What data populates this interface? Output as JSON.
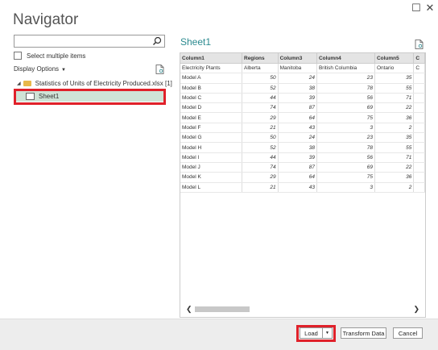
{
  "window": {
    "maximize_glyph": "☐",
    "close_glyph": "✕"
  },
  "title": "Navigator",
  "search": {
    "value": "",
    "placeholder": ""
  },
  "select_multiple_label": "Select multiple items",
  "display_options_label": "Display Options",
  "tree": {
    "file_label": "Statistics of Units of Electricity Produced.xlsx [1]",
    "sheet_label": "Sheet1"
  },
  "preview": {
    "title": "Sheet1",
    "headers": [
      "Column1",
      "Regions",
      "Column3",
      "Column4",
      "Column5",
      "C"
    ],
    "subheader": [
      "Electricity Plants",
      "Alberta",
      "Manitoba",
      "British Columbia",
      "Ontario",
      "C"
    ],
    "rows": [
      [
        "Model A",
        "50",
        "24",
        "23",
        "35"
      ],
      [
        "Model B",
        "52",
        "38",
        "78",
        "55"
      ],
      [
        "Model C",
        "44",
        "39",
        "56",
        "71"
      ],
      [
        "Model D",
        "74",
        "87",
        "69",
        "22"
      ],
      [
        "Model E",
        "29",
        "64",
        "75",
        "36"
      ],
      [
        "Model F",
        "21",
        "43",
        "3",
        "2"
      ],
      [
        "Model G",
        "50",
        "24",
        "23",
        "35"
      ],
      [
        "Model H",
        "52",
        "38",
        "78",
        "55"
      ],
      [
        "Model I",
        "44",
        "39",
        "56",
        "71"
      ],
      [
        "Model J",
        "74",
        "87",
        "69",
        "22"
      ],
      [
        "Model K",
        "29",
        "64",
        "75",
        "36"
      ],
      [
        "Model L",
        "21",
        "43",
        "3",
        "2"
      ]
    ]
  },
  "footer": {
    "load_label": "Load",
    "transform_label": "Transform Data",
    "cancel_label": "Cancel"
  },
  "colors": {
    "highlight": "#e0212a",
    "selected_bg": "#cfe3d6",
    "accent": "#2b8a8f"
  }
}
